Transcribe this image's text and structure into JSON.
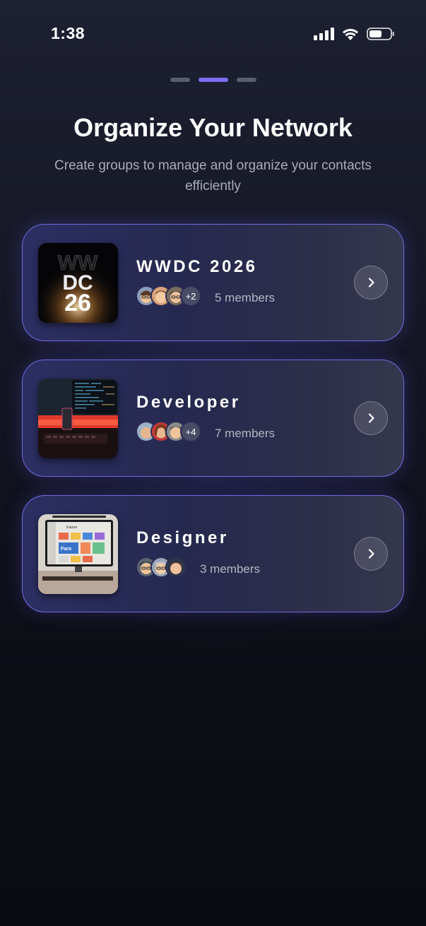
{
  "status_bar": {
    "time": "1:38"
  },
  "onboarding": {
    "page_count": 3,
    "active_page": 2,
    "title": "Organize Your Network",
    "subtitle": "Create groups to manage and organize your contacts efficiently"
  },
  "groups": [
    {
      "name": "WWDC 2026",
      "extra_members": "+2",
      "members_label": "5 members",
      "thumb_text_1": "WW",
      "thumb_text_2": "DC",
      "thumb_text_3": "26"
    },
    {
      "name": "Developer",
      "extra_members": "+4",
      "members_label": "7 members"
    },
    {
      "name": "Designer",
      "extra_members": "",
      "members_label": "3 members",
      "thumb_text_1": "Kaizen",
      "thumb_text_2": "Faro"
    }
  ],
  "colors": {
    "accent": "#7f6cf5",
    "card_border": "#7d73f5",
    "background_top": "#1d2031",
    "background_bottom": "#0a0b11"
  },
  "icons": [
    "cellular-signal-icon",
    "wifi-icon",
    "battery-icon",
    "chevron-right-icon"
  ]
}
